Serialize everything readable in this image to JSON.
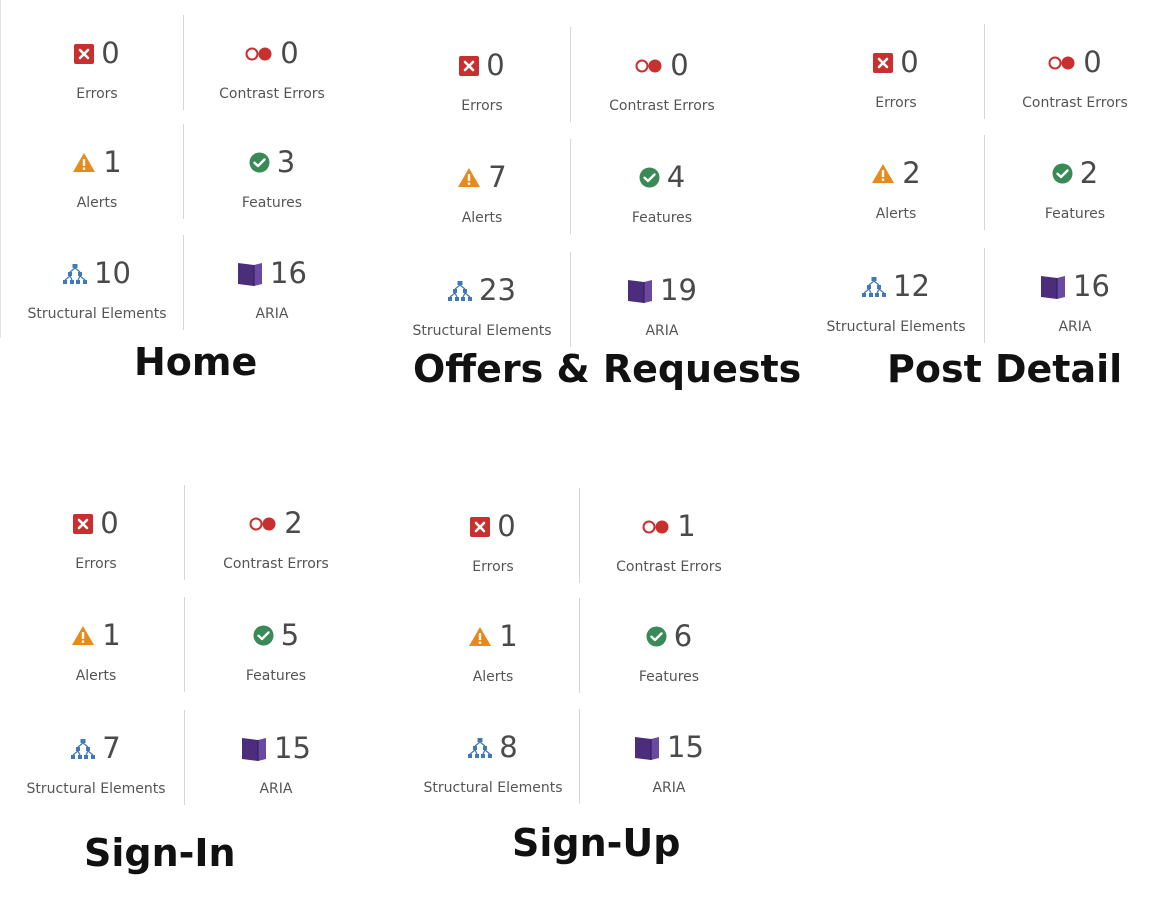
{
  "labels": {
    "errors": "Errors",
    "contrast": "Contrast Errors",
    "alerts": "Alerts",
    "features": "Features",
    "structural": "Structural Elements",
    "aria": "ARIA"
  },
  "colors": {
    "error": "#c8302f",
    "contrast": "#c8302f",
    "alert": "#e8891b",
    "feature": "#3a8a58",
    "structural": "#3f79b8",
    "aria": "#4b2d7c"
  },
  "panels": [
    {
      "title": "Home",
      "errors": "0",
      "contrast": "0",
      "alerts": "1",
      "features": "3",
      "structural": "10",
      "aria": "16"
    },
    {
      "title": "Offers & Requests",
      "errors": "0",
      "contrast": "0",
      "alerts": "7",
      "features": "4",
      "structural": "23",
      "aria": "19"
    },
    {
      "title": "Post Detail",
      "errors": "0",
      "contrast": "0",
      "alerts": "2",
      "features": "2",
      "structural": "12",
      "aria": "16"
    },
    {
      "title": "Sign-In",
      "errors": "0",
      "contrast": "2",
      "alerts": "1",
      "features": "5",
      "structural": "7",
      "aria": "15"
    },
    {
      "title": "Sign-Up",
      "errors": "0",
      "contrast": "1",
      "alerts": "1",
      "features": "6",
      "structural": "8",
      "aria": "15"
    }
  ]
}
